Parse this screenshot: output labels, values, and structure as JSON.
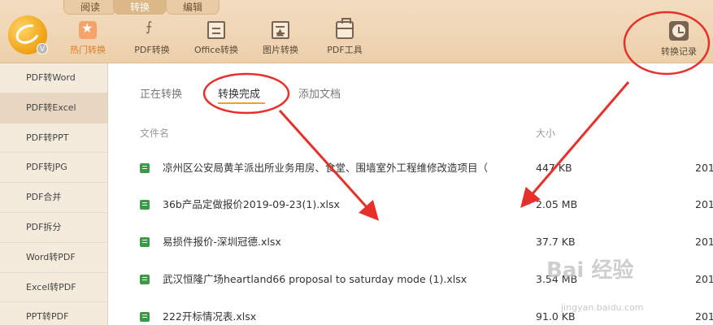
{
  "top_tabs": [
    "阅读",
    "转换",
    "编辑"
  ],
  "tools": [
    "热门转换",
    "PDF转换",
    "Office转换",
    "图片转换",
    "PDF工具"
  ],
  "record_label": "转换记录",
  "logo_badge": "V",
  "sidebar": [
    "PDF转Word",
    "PDF转Excel",
    "PDF转PPT",
    "PDF转JPG",
    "PDF合并",
    "PDF拆分",
    "Word转PDF",
    "Excel转PDF",
    "PPT转PDF"
  ],
  "subtabs": [
    "正在转换",
    "转换完成",
    "添加文档"
  ],
  "columns": {
    "name": "文件名",
    "size": "大小"
  },
  "files": [
    {
      "name": "凉州区公安局黄羊派出所业务用房、食堂、围墙室外工程维修改造项目（",
      "size": "447 KB",
      "date": "201"
    },
    {
      "name": "36b产品定做报价2019-09-23(1).xlsx",
      "size": "2.05 MB",
      "date": "201"
    },
    {
      "name": "易损件报价-深圳冠德.xlsx",
      "size": "37.7 KB",
      "date": "201"
    },
    {
      "name": "武汉恒隆广场heartland66 proposal to saturday mode (1).xlsx",
      "size": "3.54 MB",
      "date": "201"
    },
    {
      "name": "222开标情况表.xlsx",
      "size": "91.0 KB",
      "date": "201"
    }
  ],
  "watermark": {
    "main": "Bai 经验",
    "sub": "jingyan.baidu.com"
  },
  "colors": {
    "accent": "#e67a22",
    "annotation": "#e8302a",
    "excel": "#3a9a47"
  }
}
